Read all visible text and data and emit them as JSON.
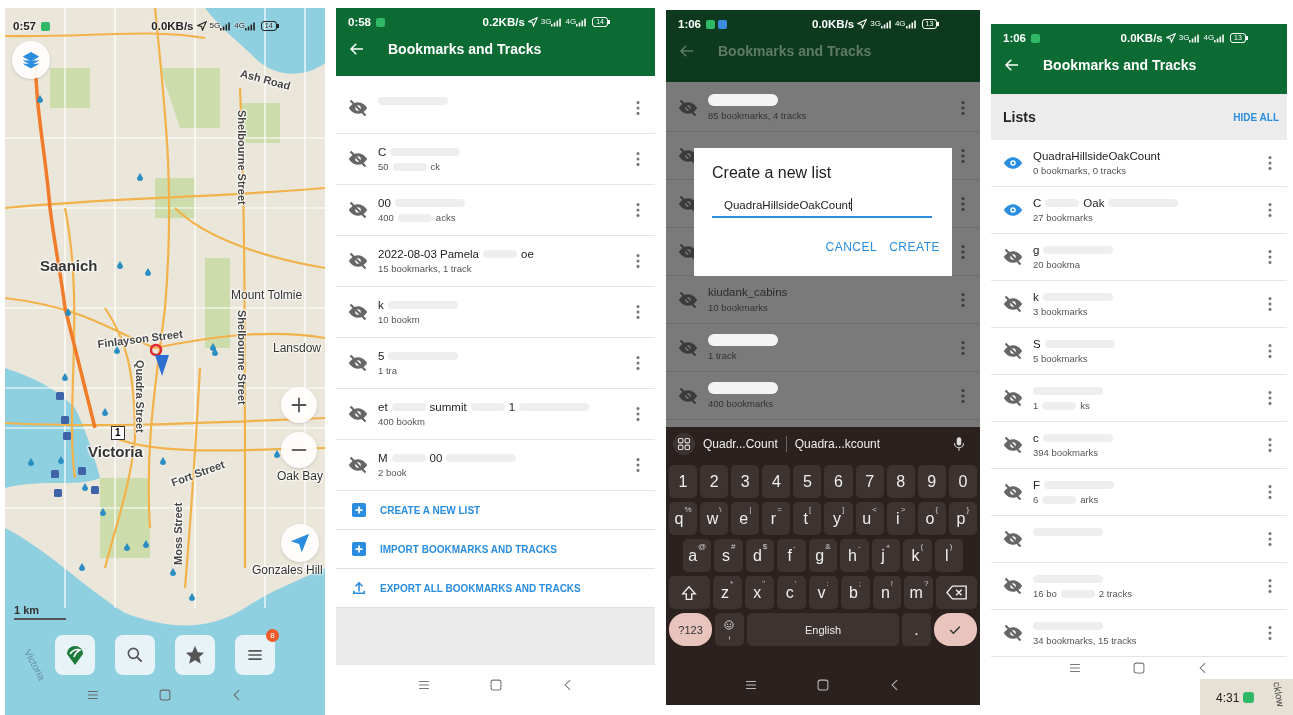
{
  "map_screen": {
    "status": {
      "time": "0:57",
      "notification_icons": [
        {
          "color": "#2fb866"
        }
      ],
      "speed": "0.0KB/s",
      "networks": [
        "5G",
        "4G"
      ],
      "battery": "14"
    },
    "labels": [
      {
        "text": "Ash Road",
        "kind": "road"
      },
      {
        "text": "Shelbourne Street",
        "kind": "road"
      },
      {
        "text": "Saanich",
        "kind": "city"
      },
      {
        "text": "Mount Tolmie",
        "kind": "area"
      },
      {
        "text": "Finlayson Street",
        "kind": "road"
      },
      {
        "text": "Lansdow",
        "kind": "area"
      },
      {
        "text": "Quadra Street",
        "kind": "road"
      },
      {
        "text": "Shelbourne Street",
        "kind": "road"
      },
      {
        "text": "Victoria",
        "kind": "city"
      },
      {
        "text": "Fort Street",
        "kind": "road"
      },
      {
        "text": "Oak Bay",
        "kind": "area"
      },
      {
        "text": "Moss Street",
        "kind": "road"
      },
      {
        "text": "Gonzales Hill",
        "kind": "area"
      },
      {
        "text": "Victoria",
        "kind": "water"
      }
    ],
    "route_shield": "1",
    "scale": "1 km",
    "menu_badge": "8"
  },
  "list_screens": [
    {
      "status": {
        "time": "0:58",
        "notification_icons": [
          {
            "color": "#2fb866"
          }
        ],
        "speed": "0.2KB/s",
        "networks": [
          "3G",
          "4G"
        ],
        "battery": "14"
      },
      "title": "Bookmarks and Tracks",
      "rows": [
        {
          "name": [],
          "subtitle": [],
          "visible": false,
          "redacted": true
        },
        {
          "name": [
            "C"
          ],
          "subtitle": [
            "50",
            "ck"
          ],
          "visible": false,
          "redacted": true
        },
        {
          "name": [
            "00"
          ],
          "subtitle": [
            "400",
            "acks"
          ],
          "visible": false,
          "redacted": true
        },
        {
          "name": [
            "2022-08-03 Pamela",
            "oe"
          ],
          "subtitle": [
            "15 bookmarks, 1 track"
          ],
          "visible": false,
          "redacted": false
        },
        {
          "name": [
            "k"
          ],
          "subtitle": [
            "10 bookm"
          ],
          "visible": false,
          "redacted": true
        },
        {
          "name": [
            "5"
          ],
          "subtitle": [
            "1 tra"
          ],
          "visible": false,
          "redacted": true
        },
        {
          "name": [
            "et",
            "summit",
            "1"
          ],
          "subtitle": [
            "400 bookm"
          ],
          "visible": false,
          "redacted": true
        },
        {
          "name": [
            "M",
            "00"
          ],
          "subtitle": [
            "2 book"
          ],
          "visible": false,
          "redacted": true
        }
      ],
      "actions": [
        {
          "label": "CREATE A NEW LIST",
          "kind": "add"
        },
        {
          "label": "IMPORT BOOKMARKS AND TRACKS",
          "kind": "add"
        },
        {
          "label": "EXPORT ALL BOOKMARKS AND TRACKS",
          "kind": "export"
        }
      ]
    },
    {
      "status": {
        "time": "1:06",
        "notification_icons": [
          {
            "color": "#2fb866"
          }
        ],
        "speed": "0.0KB/s",
        "networks": [
          "3G",
          "4G"
        ],
        "battery": "13"
      },
      "title": "Bookmarks and Tracks",
      "section": {
        "title": "Lists",
        "action": "HIDE ALL"
      },
      "rows": [
        {
          "name": [
            "QuadraHillsideOakCount"
          ],
          "subtitle": [
            "0 bookmarks, 0 tracks"
          ],
          "visible": true,
          "redacted": false
        },
        {
          "name": [
            "C",
            "Oak"
          ],
          "subtitle": [
            "27 bookmarks"
          ],
          "visible": true,
          "redacted": true
        },
        {
          "name": [
            "g"
          ],
          "subtitle": [
            "20 bookma"
          ],
          "visible": false,
          "redacted": true
        },
        {
          "name": [
            "k"
          ],
          "subtitle": [
            "3 bookmarks"
          ],
          "visible": false,
          "redacted": true
        },
        {
          "name": [
            "S"
          ],
          "subtitle": [
            "5 bookmarks"
          ],
          "visible": false,
          "redacted": true
        },
        {
          "name": [],
          "subtitle": [
            "1",
            "ks"
          ],
          "visible": false,
          "redacted": true
        },
        {
          "name": [
            "c"
          ],
          "subtitle": [
            "394 bookmarks"
          ],
          "visible": false,
          "redacted": true
        },
        {
          "name": [
            "F"
          ],
          "subtitle": [
            "6",
            "arks"
          ],
          "visible": false,
          "redacted": true
        },
        {
          "name": [],
          "subtitle": [],
          "visible": false,
          "redacted": true
        },
        {
          "name": [],
          "subtitle": [
            "16 bo",
            "2 tracks"
          ],
          "visible": false,
          "redacted": true
        },
        {
          "name": [],
          "subtitle": [
            "34 bookmarks, 15 tracks"
          ],
          "visible": false,
          "redacted": true
        }
      ]
    }
  ],
  "dialog_screen": {
    "status": {
      "time": "1:06",
      "notification_icons": [
        {
          "color": "#2fb866"
        },
        {
          "color": "#3b8de0"
        }
      ],
      "speed": "0.0KB/s",
      "networks": [
        "3G",
        "4G"
      ],
      "battery": "13"
    },
    "title": "Bookmarks and Tracks",
    "rows": [
      {
        "name": [],
        "subtitle": [
          "85 bookmarks, 4 tracks"
        ],
        "redacted": true
      },
      {
        "name": [],
        "subtitle": [],
        "redacted": false
      },
      {
        "name": [],
        "subtitle": [],
        "redacted": false
      },
      {
        "name": [],
        "subtitle": [],
        "redacted": false
      },
      {
        "name": [
          "kiudank_cabins"
        ],
        "subtitle": [
          "10 bookmarks"
        ],
        "redacted": false
      },
      {
        "name": [],
        "subtitle": [
          "1 track"
        ],
        "redacted": true
      },
      {
        "name": [],
        "subtitle": [
          "400 bookmarks"
        ],
        "redacted": true
      }
    ],
    "dialog": {
      "title": "Create a new list",
      "value": "QuadraHillsideOakCount",
      "buttons": [
        "CANCEL",
        "CREATE"
      ]
    },
    "keyboard": {
      "suggestions": [
        "Quadr...Count",
        "Quadra...kcount"
      ],
      "number_row": [
        "1",
        "2",
        "3",
        "4",
        "5",
        "6",
        "7",
        "8",
        "9",
        "0"
      ],
      "letter_rows": [
        [
          {
            "key": "q",
            "alt": "%"
          },
          {
            "key": "w",
            "alt": "\\"
          },
          {
            "key": "e",
            "alt": "|"
          },
          {
            "key": "r",
            "alt": "="
          },
          {
            "key": "t",
            "alt": "["
          },
          {
            "key": "y",
            "alt": "]"
          },
          {
            "key": "u",
            "alt": "<"
          },
          {
            "key": "i",
            "alt": ">"
          },
          {
            "key": "o",
            "alt": "{"
          },
          {
            "key": "p",
            "alt": "}"
          }
        ],
        [
          {
            "key": "a",
            "alt": "@"
          },
          {
            "key": "s",
            "alt": "#"
          },
          {
            "key": "d",
            "alt": "$"
          },
          {
            "key": "f",
            "alt": "-"
          },
          {
            "key": "g",
            "alt": "&"
          },
          {
            "key": "h",
            "alt": "-"
          },
          {
            "key": "j",
            "alt": "+"
          },
          {
            "key": "k",
            "alt": "("
          },
          {
            "key": "l",
            "alt": ")"
          }
        ],
        [
          {
            "key": "z",
            "alt": "*"
          },
          {
            "key": "x",
            "alt": "\""
          },
          {
            "key": "c",
            "alt": "'"
          },
          {
            "key": "v",
            "alt": ":"
          },
          {
            "key": "b",
            "alt": ";"
          },
          {
            "key": "n",
            "alt": "!"
          },
          {
            "key": "m",
            "alt": "?"
          }
        ]
      ],
      "symbols_key": "?123",
      "comma_key": ",",
      "space": "English",
      "period": "."
    }
  },
  "corner_screenshot": {
    "time": "4:31",
    "map_label": "cklow"
  }
}
